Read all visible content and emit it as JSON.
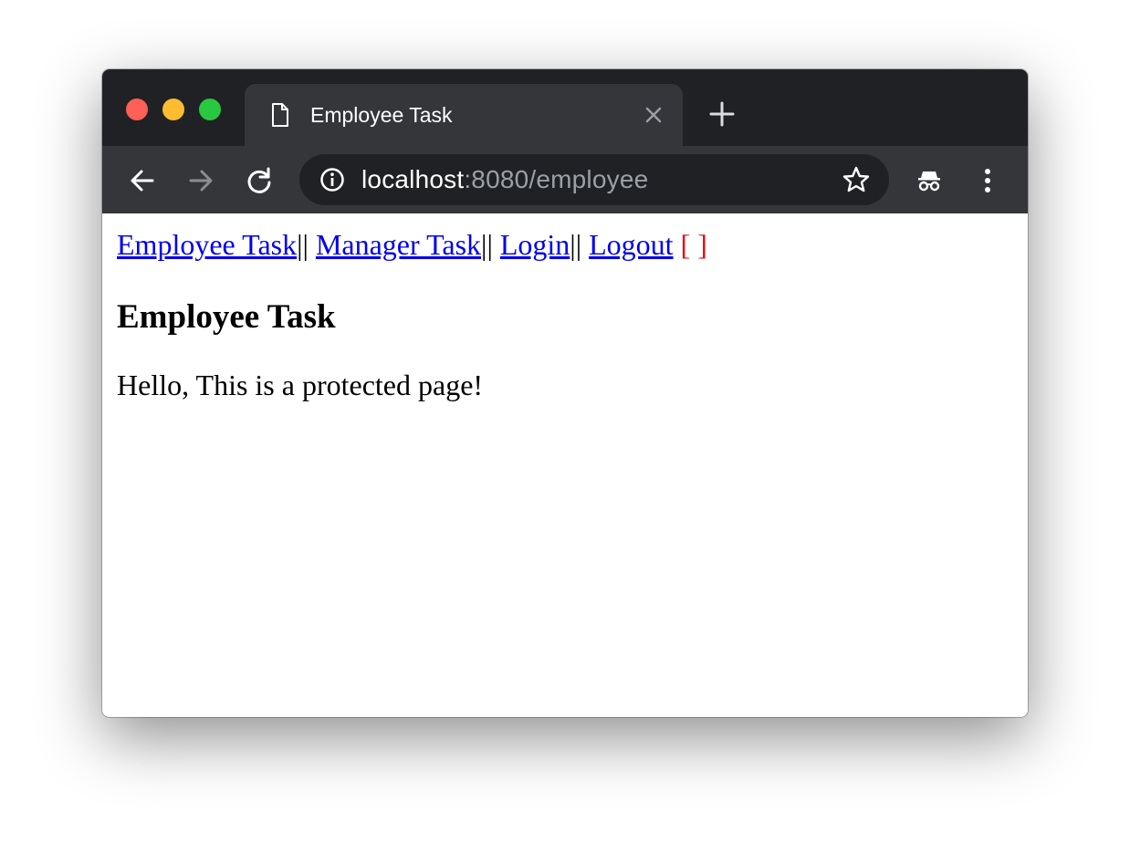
{
  "browser": {
    "tab": {
      "title": "Employee Task",
      "icon": "document-icon"
    },
    "toolbar": {
      "back_icon": "arrow-left-icon",
      "forward_icon": "arrow-right-icon",
      "reload_icon": "reload-icon",
      "url_host": "localhost",
      "url_rest": ":8080/employee",
      "info_icon": "info-icon",
      "star_icon": "star-icon",
      "incognito_icon": "incognito-icon",
      "menu_icon": "kebab-menu-icon"
    },
    "colors": {
      "titlebar": "#202124",
      "toolbar": "#35363a",
      "link": "#0000ee",
      "bracket": "#e0101a"
    }
  },
  "page": {
    "nav": {
      "employee_task": "Employee Task",
      "sep1": "||",
      "manager_task": "Manager Task",
      "sep2": "||",
      "login": "Login",
      "sep3": "||",
      "logout": "Logout",
      "user_bracket": "[ ]"
    },
    "title": "Employee Task",
    "message": "Hello, This is a protected page!"
  }
}
